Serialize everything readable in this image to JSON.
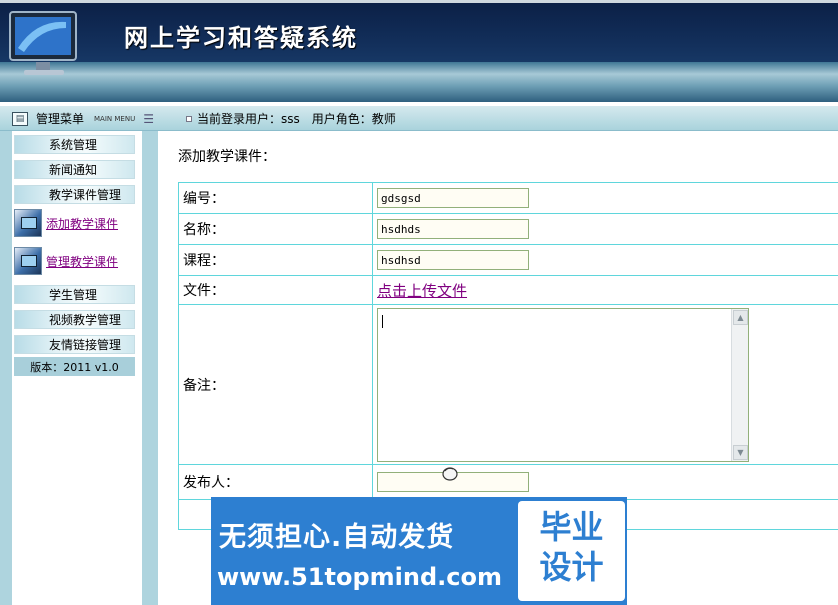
{
  "header": {
    "title": "网上学习和答疑系统"
  },
  "menu_bar": {
    "title": "管理菜单",
    "subtitle": "MAIN MENU",
    "user_label": "当前登录用户：sss",
    "role_label": "用户角色：教师"
  },
  "sidebar": {
    "items": [
      {
        "label": "系统管理"
      },
      {
        "label": "新闻通知"
      },
      {
        "label": "教学课件管理"
      }
    ],
    "links": [
      {
        "label": "添加教学课件"
      },
      {
        "label": "管理教学课件"
      }
    ],
    "items2": [
      {
        "label": "学生管理"
      },
      {
        "label": "视频教学管理"
      },
      {
        "label": "友情链接管理"
      }
    ],
    "version": "版本：2011 v1.0"
  },
  "main": {
    "title": "添加教学课件：",
    "fields": {
      "number": {
        "label": "编号：",
        "value": "gdsgsd"
      },
      "name": {
        "label": "名称：",
        "value": "hsdhds"
      },
      "course": {
        "label": "课程：",
        "value": "hsdhsd"
      },
      "file": {
        "label": "文件：",
        "link": "点击上传文件"
      },
      "remark": {
        "label": "备注：",
        "value": ""
      },
      "publisher": {
        "label": "发布人：",
        "value": ""
      }
    }
  },
  "banner": {
    "slogan": "无须担心.自动发货",
    "url": "www.51topmind.com",
    "badge": "毕业\n设计"
  },
  "colors": {
    "accent": "#2d7fd1",
    "rail": "#aed4de",
    "border": "#5fd6dc",
    "visited_link": "#800080"
  }
}
